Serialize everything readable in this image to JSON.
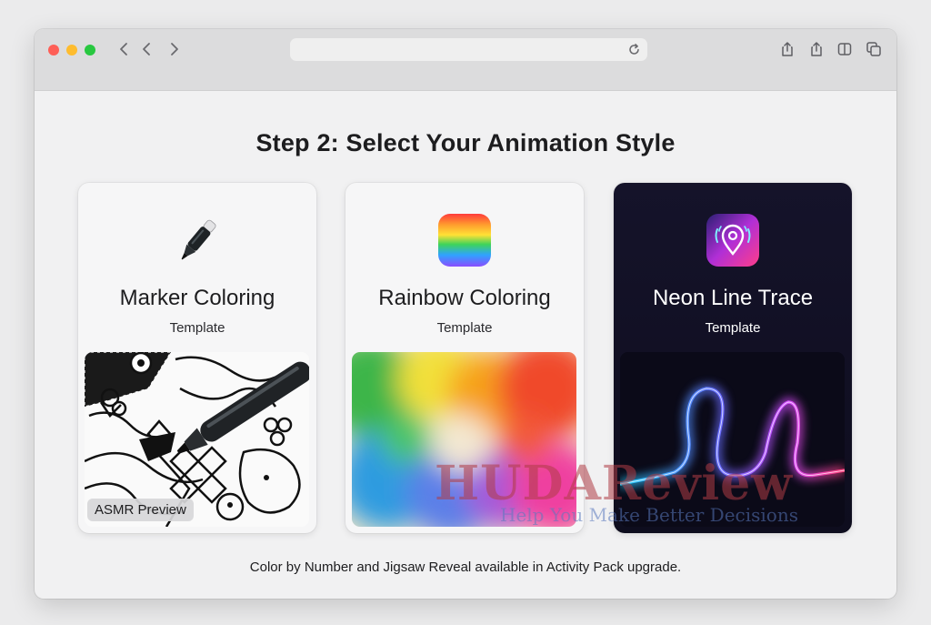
{
  "browser": {
    "controls": [
      "close",
      "minimize",
      "zoom"
    ],
    "toolbar_icons": [
      "share-icon",
      "share-alt-icon",
      "sidebar-icon",
      "tabs-icon"
    ]
  },
  "page": {
    "title": "Step 2: Select Your Animation Style",
    "footnote": "Color by Number and Jigsaw Reveal available in Activity Pack upgrade."
  },
  "cards": [
    {
      "title": "Marker Coloring",
      "subtitle": "Template",
      "icon": "marker-icon",
      "badge": "ASMR Preview"
    },
    {
      "title": "Rainbow Coloring",
      "subtitle": "Template",
      "icon": "rainbow-icon"
    },
    {
      "title": "Neon Line Trace",
      "subtitle": "Template",
      "icon": "neon-location-icon"
    }
  ],
  "watermark": {
    "title": "HUDAReview",
    "tagline": "Help You Make Better Decisions"
  }
}
